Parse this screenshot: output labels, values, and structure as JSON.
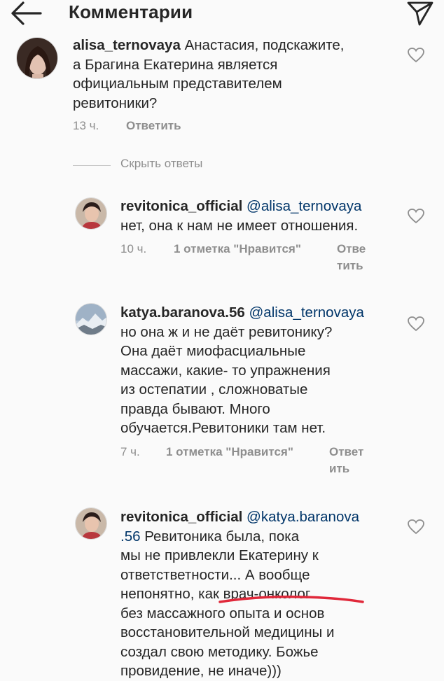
{
  "header": {
    "title": "Комментарии",
    "back_icon": "arrow-left-icon",
    "send_icon": "paper-plane-icon"
  },
  "comments": [
    {
      "username": "alisa_ternovaya",
      "lines": [
        "Анастасия, подскажите,",
        "а Брагина Екатерина является",
        "официальным представителем",
        "ревитоники?"
      ],
      "time": "13 ч.",
      "reply": "Ответить"
    }
  ],
  "hide_replies": "Скрыть ответы",
  "replies": [
    {
      "username": "revitonica_official",
      "mention": "@alisa_ternovaya",
      "lines": [
        "нет, она к нам не имеет отношения."
      ],
      "time": "10 ч.",
      "likes": "1 отметка \"Нравится\"",
      "reply_1": "Отве",
      "reply_2": "тить"
    },
    {
      "username": "katya.baranova.56",
      "mention": "@alisa_ternovaya",
      "lines": [
        "но она ж и не даёт ревитонику?",
        "Она даёт миофасциальные",
        "массажи,  какие- то упражнения",
        "из остепатии , сложноватые",
        "правда бывают. Много",
        "обучается.Ревитоники там нет."
      ],
      "time": "7 ч.",
      "likes": "1 отметка \"Нравится\"",
      "reply_1": "Ответ",
      "reply_2": "ить"
    },
    {
      "username": "revitonica_official",
      "mention_1": "@katya.baranova",
      "mention_2": ".56",
      "first_line_rest": " Ревитоника была, пока",
      "lines": [
        "мы не привлекли Екатерину к",
        "ответстветности... А вообще",
        "непонятно, как врач-онколог",
        "без массажного  опыта и основ",
        "восстановительной медицины  и",
        "создал свою  методику. Божье",
        "провидение, не иначе)))"
      ]
    }
  ],
  "colors": {
    "text": "#262626",
    "secondary": "#8e8e8e",
    "mention": "#003569",
    "underline_mark": "#e0283a"
  }
}
